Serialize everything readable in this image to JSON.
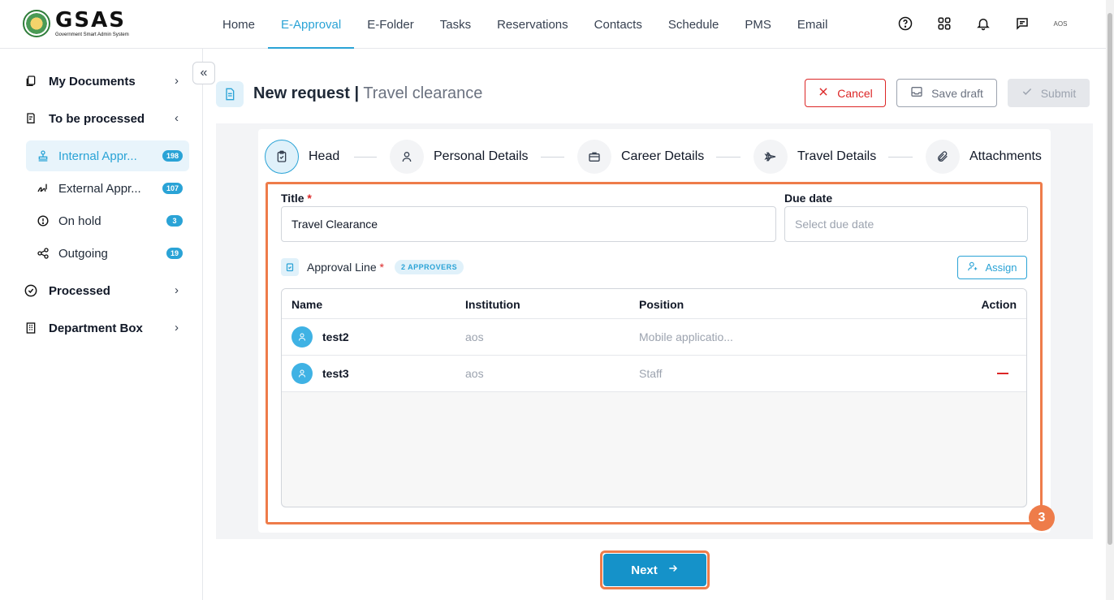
{
  "logo": {
    "main": "GSAS",
    "sub": "Government Smart Admin System"
  },
  "nav": [
    {
      "label": "Home"
    },
    {
      "label": "E-Approval"
    },
    {
      "label": "E-Folder"
    },
    {
      "label": "Tasks"
    },
    {
      "label": "Reservations"
    },
    {
      "label": "Contacts"
    },
    {
      "label": "Schedule"
    },
    {
      "label": "PMS"
    },
    {
      "label": "Email"
    }
  ],
  "nav_active": "E-Approval",
  "top_icons": [
    "help-icon",
    "apps-grid-icon",
    "bell-icon",
    "chat-icon"
  ],
  "user_avatar": "AOS",
  "sidebar": {
    "groups": [
      {
        "label": "My Documents",
        "icon": "documents-icon"
      },
      {
        "label": "To be processed",
        "icon": "clipboard-icon"
      },
      {
        "label": "Processed",
        "icon": "check-circle-icon"
      },
      {
        "label": "Department Box",
        "icon": "building-icon"
      }
    ],
    "subitems": [
      {
        "label": "Internal Appr...",
        "badge": "198",
        "icon": "stamp-icon"
      },
      {
        "label": "External Appr...",
        "badge": "107",
        "icon": "signature-icon"
      },
      {
        "label": "On hold",
        "badge": "3",
        "icon": "alert-circle-icon"
      },
      {
        "label": "Outgoing",
        "badge": "19",
        "icon": "share-icon"
      }
    ]
  },
  "header": {
    "title": "New request",
    "separator": "|",
    "subtitle": "Travel clearance"
  },
  "actions": {
    "cancel": "Cancel",
    "save_draft": "Save draft",
    "submit": "Submit"
  },
  "steps": [
    {
      "label": "Head",
      "icon": "clipboard-icon"
    },
    {
      "label": "Personal Details",
      "icon": "person-icon"
    },
    {
      "label": "Career Details",
      "icon": "briefcase-icon"
    },
    {
      "label": "Travel Details",
      "icon": "plane-icon"
    },
    {
      "label": "Attachments",
      "icon": "paperclip-icon"
    }
  ],
  "form": {
    "title_label": "Title",
    "required_mark": "*",
    "title_value": "Travel Clearance",
    "due_label": "Due date",
    "due_placeholder": "Select due date"
  },
  "approval": {
    "label": "Approval Line",
    "badge": "2 APPROVERS",
    "assign": "Assign",
    "columns": {
      "name": "Name",
      "institution": "Institution",
      "position": "Position",
      "action": "Action"
    },
    "rows": [
      {
        "name": "test2",
        "institution": "aos",
        "position": "Mobile applicatio..."
      },
      {
        "name": "test3",
        "institution": "aos",
        "position": "Staff"
      }
    ]
  },
  "annotation_number": "3",
  "next_label": "Next",
  "colors": {
    "accent": "#2aa3d6",
    "primary_button": "#1592c9",
    "danger": "#dc2626",
    "highlight": "#ee7c4a"
  }
}
